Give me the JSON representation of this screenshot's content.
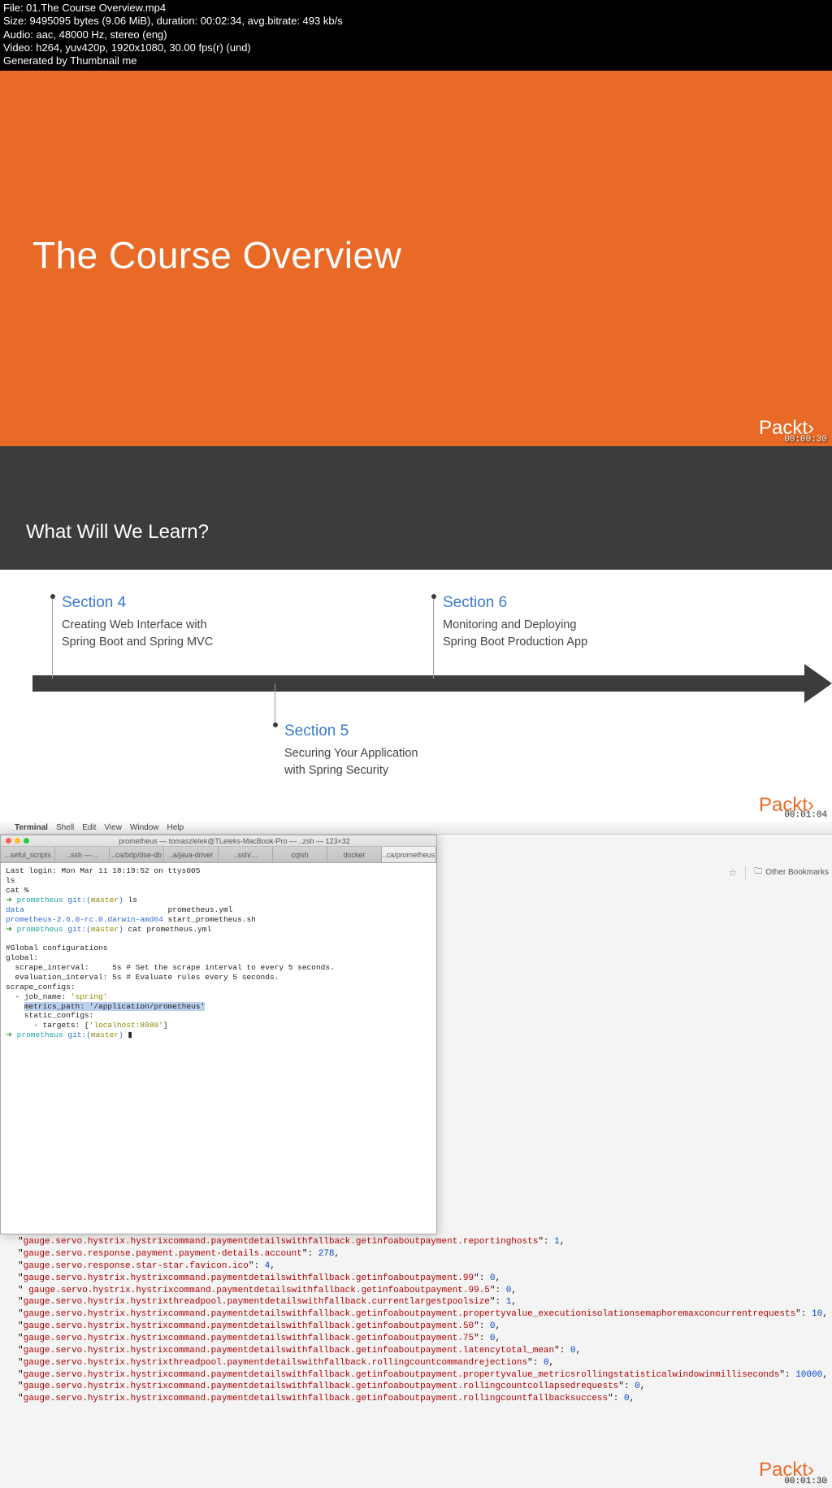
{
  "meta": {
    "line1": "File: 01.The Course Overview.mp4",
    "line2": "Size: 9495095 bytes (9.06 MiB), duration: 00:02:34, avg.bitrate: 493 kb/s",
    "line3": "Audio: aac, 48000 Hz, stereo (eng)",
    "line4": "Video: h264, yuv420p, 1920x1080, 30.00 fps(r) (und)",
    "line5": "Generated by Thumbnail me"
  },
  "brand": {
    "name": "Packt",
    "chev": "›"
  },
  "slide1": {
    "title": "The Course Overview",
    "timestamp": "00:00:30"
  },
  "slide2": {
    "question": "What Will We Learn?",
    "sec4": {
      "title": "Section 4",
      "sub": "Creating Web Interface with\nSpring Boot and Spring MVC"
    },
    "sec5": {
      "title": "Section 5",
      "sub": "Securing Your Application\nwith Spring Security"
    },
    "sec6": {
      "title": "Section 6",
      "sub": "Monitoring and Deploying\nSpring Boot Production App"
    },
    "timestamp": "00:01:04"
  },
  "slide3": {
    "menubar": [
      "Terminal",
      "Shell",
      "Edit",
      "View",
      "Window",
      "Help"
    ],
    "window_title": "prometheus — tomaszlelek@TLeleks-MacBook-Pro — ..zsh — 123×32",
    "tabs": [
      "...seful_scripts",
      "..ssh — ..",
      "..ca/bdp/dse-db",
      "..a/java-driver",
      "..ssh/...",
      "cqlsh",
      "docker",
      "..ca/prometheus"
    ],
    "term_lines": [
      {
        "t": "Last login: Mon Mar 11 18:19:52 on ttys005"
      },
      {
        "t": "ls"
      },
      {
        "t": "cat %"
      },
      {
        "p": true,
        "cmd": "ls"
      },
      {
        "raw": "<span class=\"tb-blue\">data</span>                               prometheus.yml"
      },
      {
        "raw": "<span class=\"tb-blue\">prometheus-2.6.0-rc.0.darwin-amd64</span> start_prometheus.sh"
      },
      {
        "p": true,
        "cmd": "cat prometheus.yml"
      },
      {
        "t": ""
      },
      {
        "t": "#Global configurations"
      },
      {
        "t": "global:"
      },
      {
        "t": "  scrape_interval:     5s # Set the scrape interval to every 5 seconds."
      },
      {
        "t": "  evaluation_interval: 5s # Evaluate rules every 5 seconds."
      },
      {
        "t": "scrape_configs:"
      },
      {
        "raw": "  - job_name: <span class=\"tb-olive\">'spring'</span>"
      },
      {
        "raw": "    <span class=\"hl\">metrics_path: '/application/prometheus'</span>"
      },
      {
        "t": "    static_configs:"
      },
      {
        "raw": "      - targets: [<span class=\"tb-olive\">'localhost:8080'</span>]"
      },
      {
        "p": true,
        "cmd": "▮"
      }
    ],
    "prompt_arrow": "➜ ",
    "prompt_dir": "prometheus ",
    "prompt_git": "git:(",
    "prompt_branch": "master",
    "prompt_git_end": ") ",
    "bookmarks_label": "Other Bookmarks",
    "metrics": [
      {
        "k": "gauge.servo.hystrix.hystrixcommand.paymentdetailswithfallback.getinfoaboutpayment.reportinghosts",
        "v": "1",
        "trail": ","
      },
      {
        "k": "gauge.servo.response.payment.payment-details.account",
        "v": "278",
        "trail": ","
      },
      {
        "k": "gauge.servo.response.star-star.favicon.ico",
        "v": "4",
        "trail": ","
      },
      {
        "k": "gauge.servo.hystrix.hystrixcommand.paymentdetailswithfallback.getinfoaboutpayment.99",
        "v": "0",
        "trail": ","
      },
      {
        "k": " gauge.servo.hystrix.hystrixcommand.paymentdetailswithfallback.getinfoaboutpayment.99.5",
        "v": "0",
        "trail": ","
      },
      {
        "k": "gauge.servo.hystrix.hystrixthreadpool.paymentdetailswithfallback.currentlargestpoolsize",
        "v": "1",
        "trail": ","
      },
      {
        "k": "gauge.servo.hystrix.hystrixcommand.paymentdetailswithfallback.getinfoaboutpayment.propertyvalue_executionisolationsemaphoremaxconcurrentrequests",
        "v": "10",
        "trail": ","
      },
      {
        "k": "gauge.servo.hystrix.hystrixcommand.paymentdetailswithfallback.getinfoaboutpayment.50",
        "v": "0",
        "trail": ","
      },
      {
        "k": "gauge.servo.hystrix.hystrixcommand.paymentdetailswithfallback.getinfoaboutpayment.75",
        "v": "0",
        "trail": ","
      },
      {
        "k": "gauge.servo.hystrix.hystrixcommand.paymentdetailswithfallback.getinfoaboutpayment.latencytotal_mean",
        "v": "0",
        "trail": ","
      },
      {
        "k": "gauge.servo.hystrix.hystrixthreadpool.paymentdetailswithfallback.rollingcountcommandrejections",
        "v": "0",
        "trail": ","
      },
      {
        "k": "gauge.servo.hystrix.hystrixcommand.paymentdetailswithfallback.getinfoaboutpayment.propertyvalue_metricsrollingstatisticalwindowinmilliseconds",
        "v": "10000",
        "trail": ","
      },
      {
        "k": "gauge.servo.hystrix.hystrixcommand.paymentdetailswithfallback.getinfoaboutpayment.rollingcountcollapsedrequests",
        "v": "0",
        "trail": ","
      },
      {
        "k": "gauge.servo.hystrix.hystrixcommand.paymentdetailswithfallback.getinfoaboutpayment.rollingcountfallbacksuccess",
        "v": "0",
        "trail": ","
      }
    ],
    "timestamp": "00:01:30"
  }
}
